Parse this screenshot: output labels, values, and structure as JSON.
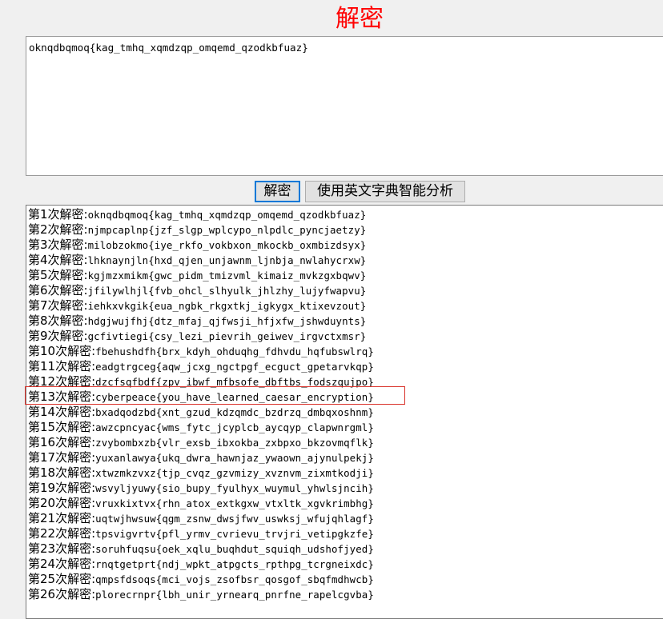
{
  "window": {
    "title": "解密"
  },
  "ciphertext_input": {
    "value": "oknqdbqmoq{kag_tmhq_xqmdzqp_omqemd_qzodkbfuaz}"
  },
  "buttons": {
    "decrypt_label": "解密",
    "analyze_label": "使用英文字典智能分析"
  },
  "colors": {
    "title": "#ff0000",
    "highlight": "#d9322a",
    "focus_border": "#0078d7"
  },
  "results": {
    "highlighted_row": 13,
    "rows": [
      {
        "prefix": "第1次解密:",
        "text": "oknqdbqmoq{kag_tmhq_xqmdzqp_omqemd_qzodkbfuaz}"
      },
      {
        "prefix": "第2次解密:",
        "text": "njmpcaplnp{jzf_slgp_wplcypo_nlpdlc_pyncjaetzy}"
      },
      {
        "prefix": "第3次解密:",
        "text": "milobzokmo{iye_rkfo_vokbxon_mkockb_oxmbizdsyx}"
      },
      {
        "prefix": "第4次解密:",
        "text": "lhknaynjln{hxd_qjen_unjawnm_ljnbja_nwlahycrxw}"
      },
      {
        "prefix": "第5次解密:",
        "text": "kgjmzxmikm{gwc_pidm_tmizvml_kimaiz_mvkzgxbqwv}"
      },
      {
        "prefix": "第6次解密:",
        "text": "jfilywlhjl{fvb_ohcl_slhyulk_jhlzhy_lujyfwapvu}"
      },
      {
        "prefix": "第7次解密:",
        "text": "iehkxvkgik{eua_ngbk_rkgxtkj_igkygx_ktixevzout}"
      },
      {
        "prefix": "第8次解密:",
        "text": "hdgjwujfhj{dtz_mfaj_qjfwsji_hfjxfw_jshwduynts}"
      },
      {
        "prefix": "第9次解密:",
        "text": "gcfivtiegi{csy_lezi_pievrih_geiwev_irgvctxmsr}"
      },
      {
        "prefix": "第10次解密:",
        "text": "fbehushdfh{brx_kdyh_ohduqhg_fdhvdu_hqfubswlrq}"
      },
      {
        "prefix": "第11次解密:",
        "text": "eadgtrgceg{aqw_jcxg_ngctpgf_ecguct_gpetarvkqp}"
      },
      {
        "prefix": "第12次解密:",
        "text": "dzcfsqfbdf{zpv_ibwf_mfbsofe_dbftbs_fodszqujpo}"
      },
      {
        "prefix": "第13次解密:",
        "text": "cyberpeace{you_have_learned_caesar_encryption}"
      },
      {
        "prefix": "第14次解密:",
        "text": "bxadqodzbd{xnt_gzud_kdzqmdc_bzdrzq_dmbqxoshnm}"
      },
      {
        "prefix": "第15次解密:",
        "text": "awzcpncyac{wms_fytc_jcyplcb_aycqyp_clapwnrgml}"
      },
      {
        "prefix": "第16次解密:",
        "text": "zvybombxzb{vlr_exsb_ibxokba_zxbpxo_bkzovmqflk}"
      },
      {
        "prefix": "第17次解密:",
        "text": "yuxanlawya{ukq_dwra_hawnjaz_ywaown_ajynulpekj}"
      },
      {
        "prefix": "第18次解密:",
        "text": "xtwzmkzvxz{tjp_cvqz_gzvmizy_xvznvm_zixmtkodji}"
      },
      {
        "prefix": "第19次解密:",
        "text": "wsvyljyuwy{sio_bupy_fyulhyx_wuymul_yhwlsjncih}"
      },
      {
        "prefix": "第20次解密:",
        "text": "vruxkixtvx{rhn_atox_extkgxw_vtxltk_xgvkrimbhg}"
      },
      {
        "prefix": "第21次解密:",
        "text": "uqtwjhwsuw{qgm_zsnw_dwsjfwv_uswksj_wfujqhlagf}"
      },
      {
        "prefix": "第22次解密:",
        "text": "tpsvigvrtv{pfl_yrmv_cvrievu_trvjri_vetipgkzfe}"
      },
      {
        "prefix": "第23次解密:",
        "text": "soruhfuqsu{oek_xqlu_buqhdut_squiqh_udshofjyed}"
      },
      {
        "prefix": "第24次解密:",
        "text": "rnqtgetprt{ndj_wpkt_atpgcts_rpthpg_tcrgneixdc}"
      },
      {
        "prefix": "第25次解密:",
        "text": "qmpsfdsoqs{mci_vojs_zsofbsr_qosgof_sbqfmdhwcb}"
      },
      {
        "prefix": "第26次解密:",
        "text": "plorecrnpr{lbh_unir_yrnearq_pnrfne_rapelcgvba}"
      }
    ]
  }
}
